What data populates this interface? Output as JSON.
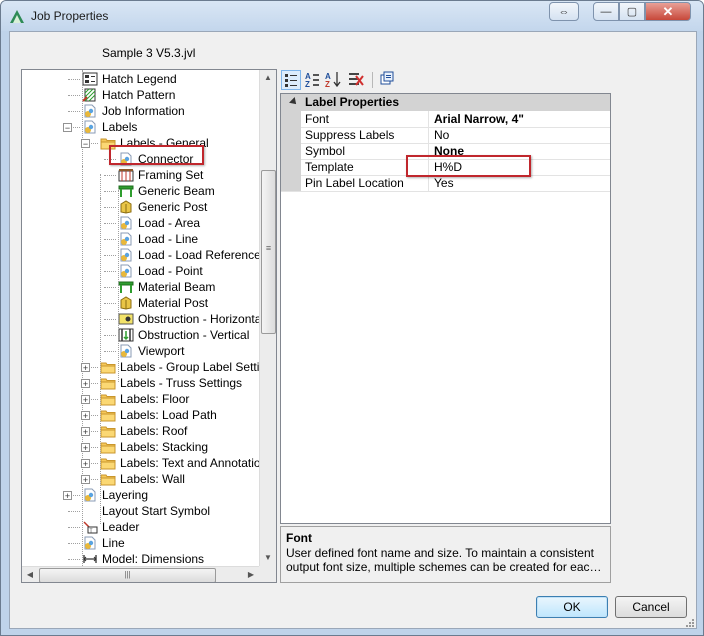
{
  "window": {
    "title": "Job Properties",
    "close_symbol": "✕",
    "min_symbol": "—",
    "back_symbol": "⇔",
    "max_symbol": "▢"
  },
  "subtitle": "Sample 3 V5.3.jvl",
  "tree": {
    "items": [
      {
        "label": "Hatch Legend",
        "icon": "legend-icon"
      },
      {
        "label": "Hatch Pattern",
        "icon": "hatch-icon"
      },
      {
        "label": "Job Information",
        "icon": "document-icon"
      },
      {
        "label": "Labels",
        "icon": "document-icon",
        "expanded": true
      },
      {
        "label": "Labels - General",
        "icon": "folder-icon",
        "expanded": true
      },
      {
        "label": "Connector",
        "icon": "document-icon"
      },
      {
        "label": "Framing Set",
        "icon": "framing-icon"
      },
      {
        "label": "Generic Beam",
        "icon": "beam-icon"
      },
      {
        "label": "Generic Post",
        "icon": "post-icon"
      },
      {
        "label": "Load - Area",
        "icon": "document-icon"
      },
      {
        "label": "Load - Line",
        "icon": "document-icon"
      },
      {
        "label": "Load - Load Reference Arrow",
        "icon": "document-icon"
      },
      {
        "label": "Load - Point",
        "icon": "document-icon"
      },
      {
        "label": "Material Beam",
        "icon": "beam-icon"
      },
      {
        "label": "Material Post",
        "icon": "post-icon"
      },
      {
        "label": "Obstruction - Horizontal",
        "icon": "obstruction-h-icon"
      },
      {
        "label": "Obstruction - Vertical",
        "icon": "obstruction-v-icon"
      },
      {
        "label": "Viewport",
        "icon": "document-icon"
      },
      {
        "label": "Labels - Group Label Settings",
        "icon": "folder-icon",
        "expanded": false
      },
      {
        "label": "Labels - Truss Settings",
        "icon": "folder-icon",
        "expanded": false
      },
      {
        "label": "Labels: Floor",
        "icon": "folder-icon",
        "expanded": false
      },
      {
        "label": "Labels: Load Path",
        "icon": "folder-icon",
        "expanded": false
      },
      {
        "label": "Labels: Roof",
        "icon": "folder-icon",
        "expanded": false
      },
      {
        "label": "Labels: Stacking",
        "icon": "folder-icon",
        "expanded": false
      },
      {
        "label": "Labels: Text and Annotation",
        "icon": "folder-icon",
        "expanded": false
      },
      {
        "label": "Labels: Wall",
        "icon": "folder-icon",
        "expanded": false
      },
      {
        "label": "Layering",
        "icon": "document-icon",
        "expanded": false
      },
      {
        "label": "Layout Start Symbol",
        "icon": "none"
      },
      {
        "label": "Leader",
        "icon": "leader-icon"
      },
      {
        "label": "Line",
        "icon": "document-icon"
      },
      {
        "label": "Model: Dimensions",
        "icon": "dimension-icon"
      }
    ],
    "scroll_grip": "≡",
    "hscroll_grip": "|||"
  },
  "toolbar": {
    "buttons": [
      "categorized-icon",
      "alphabetical-icon",
      "sort-az-icon",
      "reset-icon",
      "pages-icon"
    ]
  },
  "property_grid": {
    "category": "Label Properties",
    "rows": [
      {
        "name": "Font",
        "value": "Arial Narrow, 4\"",
        "bold": true
      },
      {
        "name": "Suppress Labels",
        "value": "No",
        "bold": false
      },
      {
        "name": "Symbol",
        "value": "None",
        "bold": true
      },
      {
        "name": "Template",
        "value": "H%D",
        "bold": false
      },
      {
        "name": "Pin Label Location",
        "value": "Yes",
        "bold": false
      }
    ]
  },
  "description": {
    "title": "Font",
    "line1": "User defined font name and size. To maintain a consistent",
    "line2": "output font size, multiple schemes can be created for each destination"
  },
  "buttons": {
    "ok": "OK",
    "cancel": "Cancel"
  },
  "colors": {
    "highlight": "#c0272d",
    "folder": "#f5c85a",
    "beam": "#2f9e2f"
  }
}
